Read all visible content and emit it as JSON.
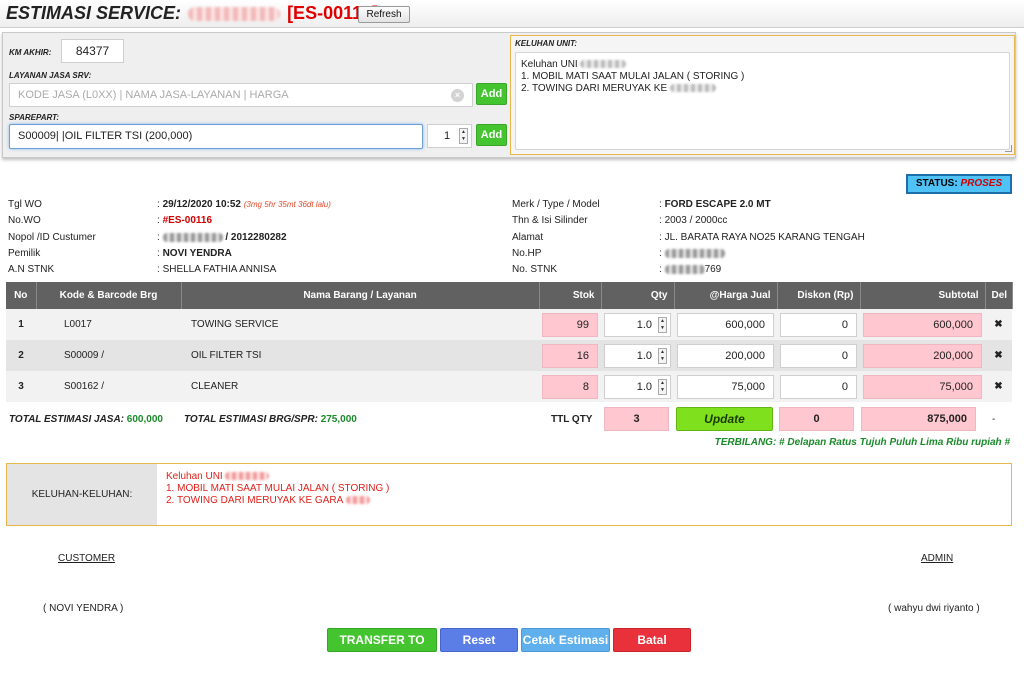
{
  "header": {
    "title_prefix": "ESTIMASI SERVICE:",
    "wo_code": "[ES-00116]",
    "refresh_label": "Refresh"
  },
  "form": {
    "km_label": "KM AKHIR:",
    "km_value": "84377",
    "layanan_label": "LAYANAN JASA SRV:",
    "layanan_placeholder": "KODE JASA (L0XX) | NAMA JASA-LAYANAN | HARGA",
    "add_label": "Add",
    "sparepart_label": "SPAREPART:",
    "sparepart_value": "S00009| |OIL FILTER TSI (200,000)",
    "sparepart_qty": "1",
    "keluhan_label": "KELUHAN UNIT:",
    "keluhan_line1": "Keluhan UNI",
    "keluhan_line2": "1. MOBIL MATI SAAT MULAI JALAN ( STORING )",
    "keluhan_line3": "2. TOWING DARI MERUYAK KE"
  },
  "status": {
    "label": "STATUS:",
    "value": "PROSES"
  },
  "info": {
    "tgl_wo_label": "Tgl WO",
    "tgl_wo_value": "29/12/2020 10:52",
    "tgl_wo_ago": "(3mg 5hr 35mt 36dt lalu)",
    "no_wo_label": "No.WO",
    "no_wo_value": "#ES-00116",
    "nopol_label": "Nopol /ID Custumer",
    "nopol_value": "/ 2012280282",
    "pemilik_label": "Pemilik",
    "pemilik_value": "NOVI YENDRA",
    "an_stnk_label": "A.N STNK",
    "an_stnk_value": "SHELLA FATHIA ANNISA",
    "merk_label": "Merk / Type / Model",
    "merk_value": "FORD ESCAPE 2.0 MT",
    "thn_label": "Thn & Isi Silinder",
    "thn_value": "2003 / 2000cc",
    "alamat_label": "Alamat",
    "alamat_value": "JL. BARATA RAYA NO25 KARANG TENGAH",
    "nohp_label": "No.HP",
    "nostnk_label": "No. STNK",
    "nostnk_value": "769",
    "sep": ":"
  },
  "table": {
    "headers": [
      "No",
      "Kode & Barcode Brg",
      "Nama Barang / Layanan",
      "Stok",
      "Qty",
      "@Harga Jual",
      "Diskon (Rp)",
      "Subtotal",
      "Del"
    ],
    "rows": [
      {
        "no": "1",
        "kode": "L0017",
        "nama": "TOWING SERVICE",
        "stok": "99",
        "qty": "1.0",
        "harga": "600,000",
        "diskon": "0",
        "subtotal": "600,000"
      },
      {
        "no": "2",
        "kode": "S00009 /",
        "nama": "OIL FILTER TSI",
        "stok": "16",
        "qty": "1.0",
        "harga": "200,000",
        "diskon": "0",
        "subtotal": "200,000"
      },
      {
        "no": "3",
        "kode": "S00162 /",
        "nama": "CLEANER",
        "stok": "8",
        "qty": "1.0",
        "harga": "75,000",
        "diskon": "0",
        "subtotal": "75,000"
      }
    ]
  },
  "totals": {
    "jasa_label": "TOTAL ESTIMASI JASA:",
    "jasa_value": "600,000",
    "brg_label": "TOTAL ESTIMASI BRG/SPR:",
    "brg_value": "275,000",
    "ttl_qty_label": "TTL QTY",
    "ttl_qty_value": "3",
    "update_label": "Update",
    "diskon_total": "0",
    "grand_total": "875,000",
    "dash": "-",
    "terbilang": "TERBILANG: # Delapan Ratus Tujuh Puluh Lima Ribu rupiah #"
  },
  "keluhan_box": {
    "label": "KELUHAN-KELUHAN:",
    "line1": "Keluhan UNI",
    "line2": "1. MOBIL MATI SAAT MULAI JALAN ( STORING )",
    "line3": "2. TOWING DARI MERUYAK KE GARA"
  },
  "signatures": {
    "customer_label": "CUSTOMER",
    "customer_name": "( NOVI YENDRA )",
    "admin_label": "ADMIN",
    "admin_name": "( wahyu dwi riyanto )"
  },
  "actions": {
    "transfer": "TRANSFER TO WO",
    "reset": "Reset",
    "cetak": "Cetak Estimasi",
    "batal": "Batal"
  },
  "colors": {
    "accent_green": "#44c530",
    "status_blue": "#4fc3f7",
    "danger_red": "#e23a2a",
    "total_pink": "#ffc7cf"
  }
}
